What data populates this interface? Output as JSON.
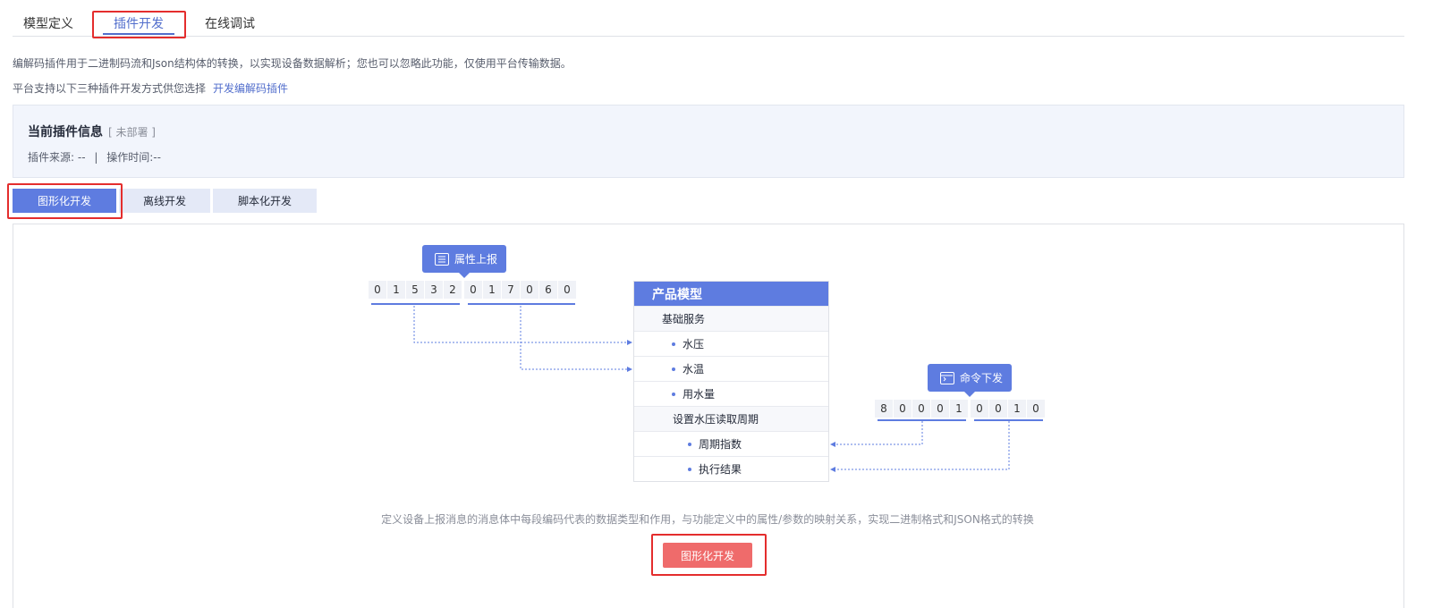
{
  "top_tabs": [
    "模型定义",
    "插件开发",
    "在线调试"
  ],
  "description": {
    "line1": "编解码插件用于二进制码流和Json结构体的转换，以实现设备数据解析；您也可以忽略此功能，仅使用平台传输数据。",
    "line2": "平台支持以下三种插件开发方式供您选择",
    "link": "开发编解码插件"
  },
  "plugin_info": {
    "title": "当前插件信息",
    "status": "[ 未部署 ]",
    "source": "插件来源: --",
    "separator": "|",
    "time": "操作时间:--"
  },
  "dev_tabs": [
    "图形化开发",
    "离线开发",
    "脚本化开发"
  ],
  "diagram": {
    "report_bubble": "属性上报",
    "command_bubble": "命令下发",
    "report_digits": [
      "0",
      "1",
      "5",
      "3",
      "2",
      "0",
      "1",
      "7",
      "0",
      "6",
      "0"
    ],
    "command_digits": [
      "8",
      "0",
      "0",
      "0",
      "1",
      "0",
      "0",
      "1",
      "0"
    ],
    "model_title": "产品模型",
    "model_rows": [
      {
        "label": "基础服务",
        "group": true
      },
      {
        "label": "水压",
        "group": false
      },
      {
        "label": "水温",
        "group": false
      },
      {
        "label": "用水量",
        "group": false
      },
      {
        "label": "设置水压读取周期",
        "group": true
      },
      {
        "label": "周期指数",
        "group": false
      },
      {
        "label": "执行结果",
        "group": false
      }
    ]
  },
  "caption": "定义设备上报消息的消息体中每段编码代表的数据类型和作用，与功能定义中的属性/参数的映射关系，实现二进制格式和JSON格式的转换",
  "primary_button": "图形化开发",
  "colors": {
    "accent": "#5e7ce0",
    "highlight": "#e42d2d",
    "button": "#ef6b6b"
  }
}
